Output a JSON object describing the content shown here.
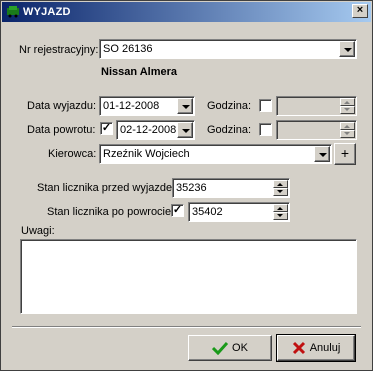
{
  "window": {
    "title": "WYJAZD",
    "close_label": "×"
  },
  "registration": {
    "label": "Nr rejestracyjny:",
    "value": "SO 26136",
    "car_name": "Nissan Almera"
  },
  "departure": {
    "date_label": "Data wyjazdu:",
    "date_value": "01-12-2008",
    "time_label": "Godzina:",
    "time_checked": false,
    "time_value": ""
  },
  "return": {
    "date_label": "Data powrotu:",
    "date_checked": true,
    "date_value": "02-12-2008",
    "time_label": "Godzina:",
    "time_checked": false,
    "time_value": ""
  },
  "driver": {
    "label": "Kierowca:",
    "value": "Rzeźnik Wojciech",
    "add_label": "+"
  },
  "odometer": {
    "before_label": "Stan licznika przed wyjazdem:",
    "before_value": "35236",
    "after_label": "Stan licznika po powrocie:",
    "after_checked": true,
    "after_value": "35402"
  },
  "notes": {
    "label": "Uwagi:",
    "value": ""
  },
  "buttons": {
    "ok_label": "OK",
    "cancel_label": "Anuluj"
  },
  "check_mark": "✓"
}
